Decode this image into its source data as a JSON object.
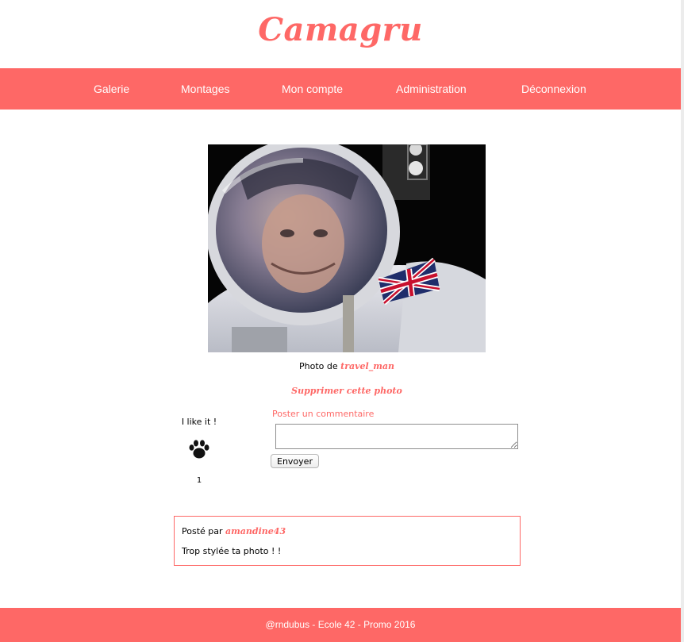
{
  "brand": {
    "title": "Camagru"
  },
  "nav": {
    "items": [
      {
        "label": "Galerie"
      },
      {
        "label": "Montages"
      },
      {
        "label": "Mon compte"
      },
      {
        "label": "Administration"
      },
      {
        "label": "Déconnexion"
      }
    ]
  },
  "photo": {
    "caption_prefix": "Photo de",
    "author": "travel_man",
    "delete_label": "Supprimer cette photo"
  },
  "like": {
    "label": "I like it !",
    "icon": "paw-icon",
    "count": "1"
  },
  "comment_form": {
    "title": "Poster un commentaire",
    "value": "",
    "submit_label": "Envoyer"
  },
  "comments": [
    {
      "prefix": "Posté par",
      "author": "amandine43",
      "text": "Trop stylée ta photo ! !"
    }
  ],
  "footer": {
    "text": "@rndubus - Ecole 42 - Promo 2016"
  },
  "colors": {
    "accent": "#fe6866",
    "background": "#ffffff"
  }
}
